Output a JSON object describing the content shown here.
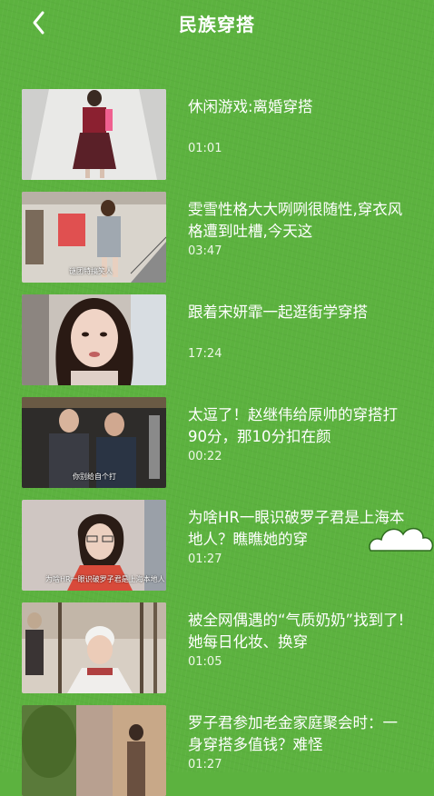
{
  "header": {
    "title": "民族穿搭",
    "back_icon": "chevron-left-icon"
  },
  "videos": [
    {
      "title": "休闲游戏:离婚穿搭",
      "duration": "01:01",
      "thumb_caption": ""
    },
    {
      "title": "雯雪性格大大咧咧很随性,穿衣风格遭到吐槽,今天这",
      "duration": "03:47",
      "thumb_caption": "谜团特搞笑人"
    },
    {
      "title": "跟着宋妍霏一起逛街学穿搭",
      "duration": "17:24",
      "thumb_caption": ""
    },
    {
      "title": "太逗了！赵继伟给原帅的穿搭打90分，那10分扣在颜",
      "duration": "00:22",
      "thumb_caption": "你别给自个打"
    },
    {
      "title": "为啥HR一眼识破罗子君是上海本地人？瞧瞧她的穿",
      "duration": "01:27",
      "thumb_caption": "为啥HR一眼识破罗子君是上海本地人"
    },
    {
      "title": "被全网偶遇的“气质奶奶”找到了!她每日化妆、换穿",
      "duration": "01:05",
      "thumb_caption": ""
    },
    {
      "title": "罗子君参加老金家庭聚会时：一身穿搭多值钱？难怪",
      "duration": "01:27",
      "thumb_caption": ""
    }
  ],
  "decor": {
    "cloud_icon": "cloud-icon"
  }
}
